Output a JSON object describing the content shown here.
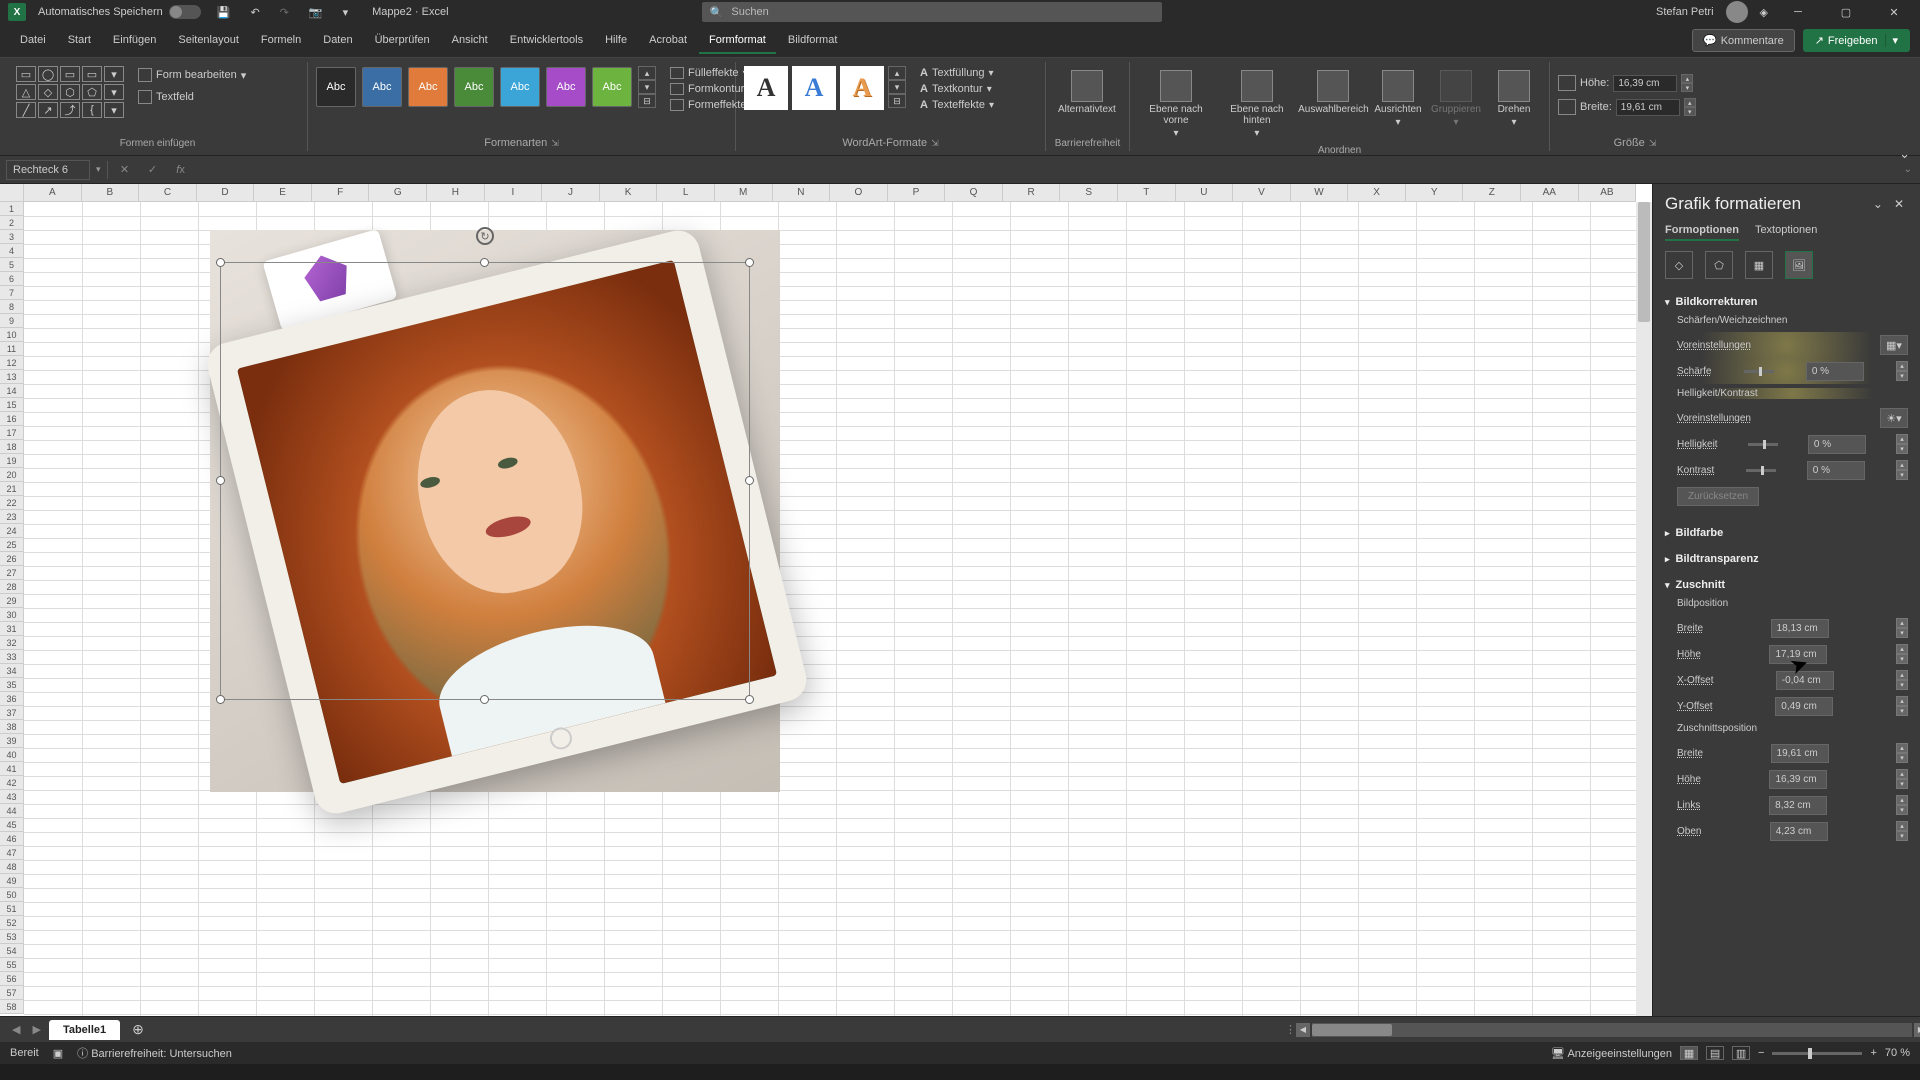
{
  "title": {
    "autosave": "Automatisches Speichern",
    "doc": "Mappe2",
    "app": "Excel",
    "search_placeholder": "Suchen",
    "user": "Stefan Petri"
  },
  "tabs": {
    "items": [
      "Datei",
      "Start",
      "Einfügen",
      "Seitenlayout",
      "Formeln",
      "Daten",
      "Überprüfen",
      "Ansicht",
      "Entwicklertools",
      "Hilfe",
      "Acrobat",
      "Formformat",
      "Bildformat"
    ],
    "active": "Formformat",
    "comments": "Kommentare",
    "share": "Freigeben"
  },
  "ribbon": {
    "g_insert": "Formen einfügen",
    "edit_form": "Form bearbeiten",
    "textfield": "Textfeld",
    "g_styles": "Formenarten",
    "style_label": "Abc",
    "fill": "Fülleffekte",
    "outline": "Formkontur",
    "effects": "Formeffekte",
    "g_wordart": "WordArt-Formate",
    "textfill": "Textfüllung",
    "textoutline": "Textkontur",
    "texteffects": "Texteffekte",
    "g_access": "Barrierefreiheit",
    "alttext": "Alternativtext",
    "g_arrange": "Anordnen",
    "front": "Ebene nach vorne",
    "back": "Ebene nach hinten",
    "selpane": "Auswahlbereich",
    "align": "Ausrichten",
    "group": "Gruppieren",
    "rotate": "Drehen",
    "g_size": "Größe",
    "height_label": "Höhe:",
    "height_val": "16,39 cm",
    "width_label": "Breite:",
    "width_val": "19,61 cm"
  },
  "formula": {
    "name": "Rechteck 6"
  },
  "columns": [
    "A",
    "B",
    "C",
    "D",
    "E",
    "F",
    "G",
    "H",
    "I",
    "J",
    "K",
    "L",
    "M",
    "N",
    "O",
    "P",
    "Q",
    "R",
    "S",
    "T",
    "U",
    "V",
    "W",
    "X",
    "Y",
    "Z",
    "AA",
    "AB"
  ],
  "panel": {
    "title": "Grafik formatieren",
    "tab_shape": "Formoptionen",
    "tab_text": "Textoptionen",
    "sec_corrections": "Bildkorrekturen",
    "sharpen_soften": "Schärfen/Weichzeichnen",
    "presets": "Voreinstellungen",
    "sharpness": "Schärfe",
    "brightness_contrast": "Helligkeit/Kontrast",
    "brightness": "Helligkeit",
    "contrast": "Kontrast",
    "val_0pct": "0 %",
    "reset": "Zurücksetzen",
    "sec_color": "Bildfarbe",
    "sec_trans": "Bildtransparenz",
    "sec_crop": "Zuschnitt",
    "pic_pos": "Bildposition",
    "width": "Breite",
    "height": "Höhe",
    "xoff": "X-Offset",
    "yoff": "Y-Offset",
    "crop_pos": "Zuschnittsposition",
    "left": "Links",
    "top": "Oben",
    "v_width": "18,13 cm",
    "v_height": "17,19 cm",
    "v_xoff": "-0,04 cm",
    "v_yoff": "0,49 cm",
    "v_cwidth": "19,61 cm",
    "v_cheight": "16,39 cm",
    "v_left": "8,32 cm",
    "v_top": "4,23 cm"
  },
  "sheets": {
    "tab1": "Tabelle1"
  },
  "status": {
    "ready": "Bereit",
    "access": "Barrierefreiheit: Untersuchen",
    "display": "Anzeigeeinstellungen",
    "zoom": "70 %"
  }
}
